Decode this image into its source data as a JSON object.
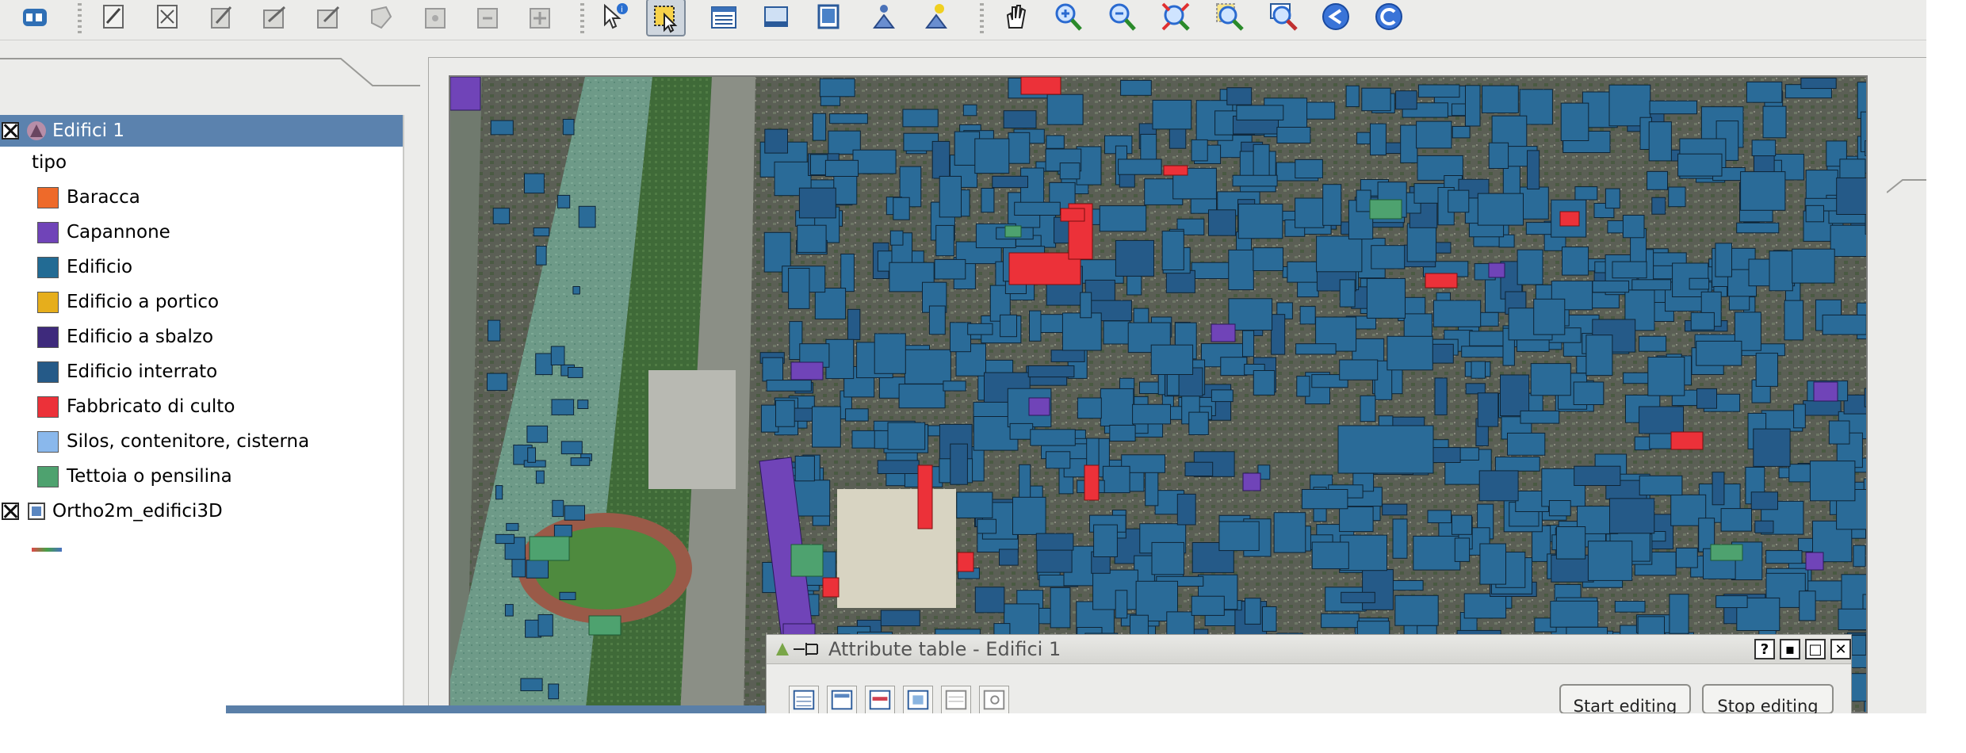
{
  "toolbar": {
    "icons": [
      "qgis-logo-icon",
      "toggle-editing-icon",
      "capture-point-icon",
      "capture-line-icon",
      "capture-polygon-icon",
      "move-feature-icon",
      "delete-feature-icon",
      "cut-features-icon",
      "copy-features-icon",
      "paste-features-icon",
      "identify-icon",
      "select-features-icon",
      "open-attribute-table-icon",
      "measure-line-icon",
      "measure-area-icon",
      "map-tips-icon",
      "new-bookmark-icon",
      "pan-icon",
      "zoom-in-icon",
      "zoom-out-icon",
      "zoom-full-icon",
      "zoom-to-selection-icon",
      "zoom-to-layer-icon",
      "zoom-last-icon",
      "zoom-next-icon"
    ]
  },
  "legend": {
    "layers": [
      {
        "name": "Edifici 1",
        "selected": true
      },
      {
        "name": "Ortho2m_edifici3D",
        "selected": false
      }
    ],
    "field_label": "tipo",
    "classes": [
      {
        "label": "Baracca",
        "color": "#ee6a2a"
      },
      {
        "label": "Capannone",
        "color": "#7044b8"
      },
      {
        "label": "Edificio",
        "color": "#226b94"
      },
      {
        "label": "Edificio a portico",
        "color": "#e6ae1c"
      },
      {
        "label": "Edificio a sbalzo",
        "color": "#3e2a7c"
      },
      {
        "label": "Edificio interrato",
        "color": "#255a88"
      },
      {
        "label": "Fabbricato di culto",
        "color": "#ec3139"
      },
      {
        "label": "Silos, contenitore, cisterna",
        "color": "#8ab8ec"
      },
      {
        "label": "Tettoia o pensilina",
        "color": "#4ea26f"
      }
    ]
  },
  "attribute_table": {
    "title": "Attribute table - Edifici 1",
    "buttons": {
      "help": "?",
      "minimize": "▪",
      "maximize": "□",
      "close": "✕"
    },
    "start_editing": "Start editing",
    "stop_editing": "Stop editing"
  },
  "colors": {
    "selection": "#5b82ae",
    "building": "#2a6b98",
    "worship": "#ec3139"
  }
}
